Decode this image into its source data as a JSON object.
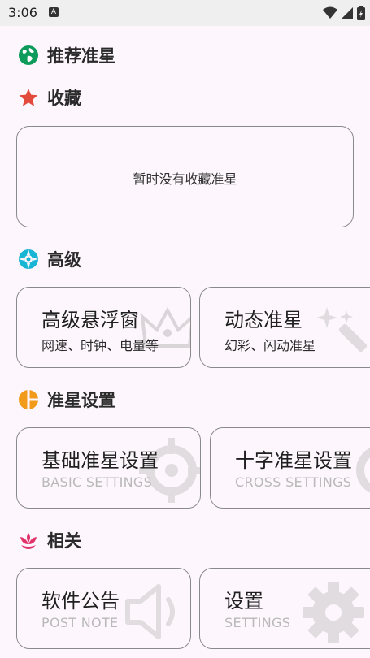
{
  "status_bar": {
    "time": "3:06",
    "notification_badge": "A"
  },
  "sections": {
    "recommended": {
      "title": "推荐准星",
      "icon": "globe-icon",
      "color": "#0c9b5a"
    },
    "favorites": {
      "title": "收藏",
      "icon": "star-icon",
      "color": "#e24a3c",
      "empty_text": "暂时没有收藏准星"
    },
    "advanced": {
      "title": "高级",
      "icon": "lifebuoy-icon",
      "color": "#19b5d4",
      "cards": [
        {
          "title": "高级悬浮窗",
          "subtitle": "网速、时钟、电量等",
          "icon": "crown-icon"
        },
        {
          "title": "动态准星",
          "subtitle": "幻彩、闪动准星",
          "icon": "magic-wand-icon"
        }
      ]
    },
    "crosshair_settings": {
      "title": "准星设置",
      "icon": "pie-chart-icon",
      "color": "#f29a1a",
      "cards": [
        {
          "title": "基础准星设置",
          "subtitle": "BASIC SETTINGS",
          "icon": "crosshair-icon"
        },
        {
          "title": "十字准星设置",
          "subtitle": "CROSS SETTINGS",
          "icon": "crosshair-icon"
        }
      ]
    },
    "related": {
      "title": "相关",
      "icon": "lotus-icon",
      "color": "#e0336a",
      "cards": [
        {
          "title": "软件公告",
          "subtitle": "POST NOTE",
          "icon": "speaker-icon"
        },
        {
          "title": "设置",
          "subtitle": "SETTINGS",
          "icon": "gear-icon"
        }
      ]
    }
  }
}
